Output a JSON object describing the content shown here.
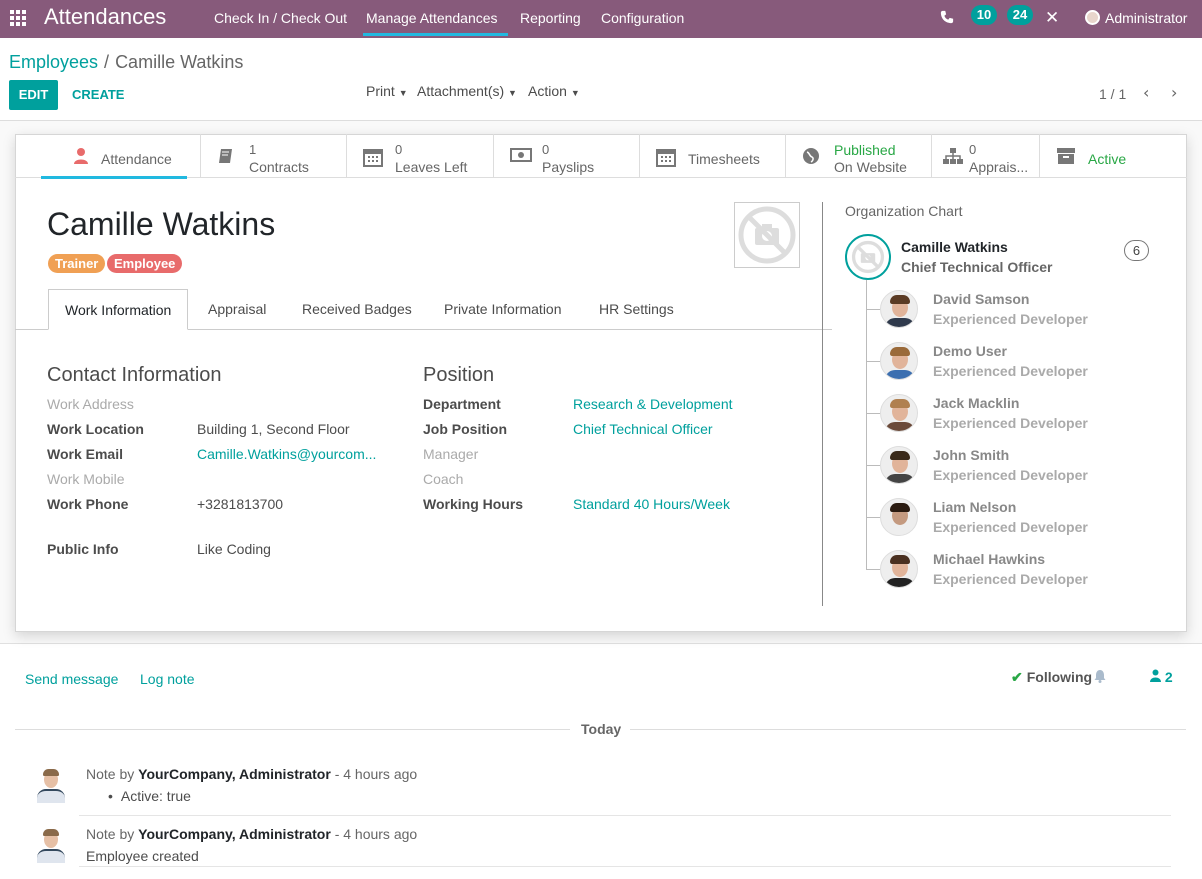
{
  "app": {
    "title": "Attendances"
  },
  "menu": [
    "Check In / Check Out",
    "Manage Attendances",
    "Reporting",
    "Configuration"
  ],
  "systray": {
    "messages": "10",
    "activities": "24",
    "user": "Administrator"
  },
  "breadcrumb": {
    "parent": "Employees",
    "separator": "/",
    "current": "Camille Watkins"
  },
  "control": {
    "edit": "EDIT",
    "create": "CREATE",
    "print": "Print",
    "attachments": "Attachment(s)",
    "action": "Action",
    "pager": "1 / 1"
  },
  "stat_buttons": [
    {
      "icon": "user-icon",
      "label": "Attendance"
    },
    {
      "icon": "book-icon",
      "value": "1",
      "label": "Contracts"
    },
    {
      "icon": "calendar-icon",
      "value": "0",
      "label": "Leaves Left"
    },
    {
      "icon": "money-icon",
      "value": "0",
      "label": "Payslips"
    },
    {
      "icon": "calendar-icon",
      "label": "Timesheets"
    },
    {
      "icon": "globe-icon",
      "value": "Published",
      "label": "On Website"
    },
    {
      "icon": "sitemap-icon",
      "value": "0",
      "label": "Apprais..."
    },
    {
      "icon": "archive-icon",
      "label": "Active"
    }
  ],
  "employee": {
    "name": "Camille Watkins",
    "tags": [
      {
        "label": "Trainer",
        "color": "#f0a054"
      },
      {
        "label": "Employee",
        "color": "#e86b6b"
      }
    ]
  },
  "tabs": [
    "Work Information",
    "Appraisal",
    "Received Badges",
    "Private Information",
    "HR Settings"
  ],
  "contact": {
    "title": "Contact Information",
    "work_address": "Work Address",
    "work_location_label": "Work Location",
    "work_location": "Building 1, Second Floor",
    "work_email_label": "Work Email",
    "work_email": "Camille.Watkins@yourcom...",
    "work_mobile": "Work Mobile",
    "work_phone_label": "Work Phone",
    "work_phone": "+3281813700",
    "public_info_label": "Public Info",
    "public_info": "Like Coding"
  },
  "position": {
    "title": "Position",
    "department_label": "Department",
    "department": "Research & Development",
    "job_label": "Job Position",
    "job": "Chief Technical Officer",
    "manager": "Manager",
    "coach": "Coach",
    "hours_label": "Working Hours",
    "hours": "Standard 40 Hours/Week"
  },
  "org_chart": {
    "title": "Organization Chart",
    "self": {
      "name": "Camille Watkins",
      "job": "Chief Technical Officer",
      "count": "6"
    },
    "subordinates": [
      {
        "name": "David Samson",
        "job": "Experienced Developer"
      },
      {
        "name": "Demo User",
        "job": "Experienced Developer"
      },
      {
        "name": "Jack Macklin",
        "job": "Experienced Developer"
      },
      {
        "name": "John Smith",
        "job": "Experienced Developer"
      },
      {
        "name": "Liam Nelson",
        "job": "Experienced Developer"
      },
      {
        "name": "Michael Hawkins",
        "job": "Experienced Developer"
      }
    ]
  },
  "chatter": {
    "send_message": "Send message",
    "log_note": "Log note",
    "following": "Following",
    "followers": "2",
    "today": "Today",
    "messages": [
      {
        "prefix": "Note by",
        "author": "YourCompany, Administrator",
        "time": "- 4 hours ago",
        "body": "Active: true",
        "bullet": true
      },
      {
        "prefix": "Note by",
        "author": "YourCompany, Administrator",
        "time": "- 4 hours ago",
        "body": "Employee created",
        "bullet": false
      }
    ]
  },
  "colors": {
    "brand": "#875a7b",
    "accent": "#00a09d",
    "tab_highlight": "#21b9e0"
  }
}
